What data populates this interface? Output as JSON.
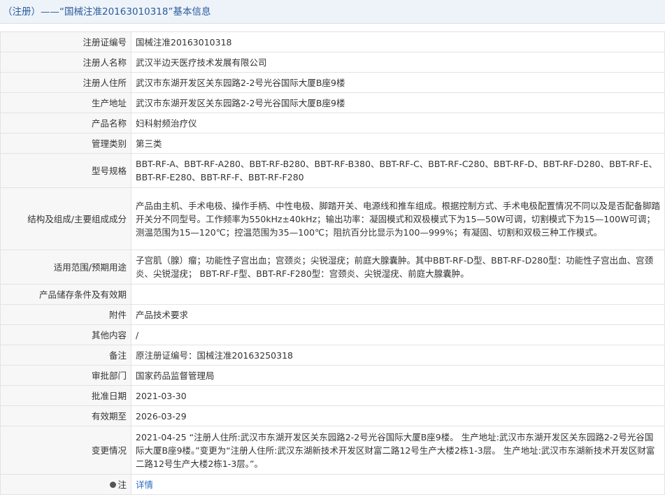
{
  "title": "（注册）——“国械注准20163010318”基本信息",
  "rows": [
    {
      "label": "注册证编号",
      "value": "国械注准20163010318"
    },
    {
      "label": "注册人名称",
      "value": "武汉半边天医疗技术发展有限公司"
    },
    {
      "label": "注册人住所",
      "value": "武汉市东湖开发区关东园路2-2号光谷国际大厦B座9楼"
    },
    {
      "label": "生产地址",
      "value": "武汉市东湖开发区关东园路2-2号光谷国际大厦B座9楼"
    },
    {
      "label": "产品名称",
      "value": "妇科射频治疗仪"
    },
    {
      "label": "管理类别",
      "value": "第三类"
    },
    {
      "label": "型号规格",
      "value": "BBT-RF-A、BBT-RF-A280、BBT-RF-B280、BBT-RF-B380、BBT-RF-C、BBT-RF-C280、BBT-RF-D、BBT-RF-D280、BBT-RF-E、BBT-RF-E280、BBT-RF-F、BBT-RF-F280"
    },
    {
      "label": "结构及组成/主要组成成分",
      "value": "产品由主机、手术电极、操作手柄、中性电极、脚踏开关、电源线和推车组成。根据控制方式、手术电极配置情况不同以及是否配备脚踏开关分不同型号。工作频率为550kHz±40kHz；输出功率：凝固模式和双极模式下为15—50W可调，切割模式下为15—100W可调；测温范围为15—120℃；控温范围为35—100℃；阻抗百分比显示为100—999%；有凝固、切割和双极三种工作模式。"
    },
    {
      "label": "适用范围/预期用途",
      "value": "子宫肌（腺）瘤；功能性子宫出血；宫颈炎；尖锐湿疣；前庭大腺囊肿。其中BBT-RF-D型、BBT-RF-D280型：功能性子宫出血、宫颈炎、尖锐湿疣； BBT-RF-F型、BBT-RF-F280型：宫颈炎、尖锐湿疣、前庭大腺囊肿。"
    },
    {
      "label": "产品储存条件及有效期",
      "value": ""
    },
    {
      "label": "附件",
      "value": "产品技术要求"
    },
    {
      "label": "其他内容",
      "value": "/"
    },
    {
      "label": "备注",
      "value": "原注册证编号：国械注准20163250318"
    },
    {
      "label": "审批部门",
      "value": "国家药品监督管理局"
    },
    {
      "label": "批准日期",
      "value": "2021-03-30"
    },
    {
      "label": "有效期至",
      "value": "2026-03-29"
    },
    {
      "label": "变更情况",
      "value": "2021-04-25 “注册人住所:武汉市东湖开发区关东园路2-2号光谷国际大厦B座9楼。 生产地址:武汉市东湖开发区关东园路2-2号光谷国际大厦B座9楼。”变更为“注册人住所:武汉东湖新技术开发区财富二路12号生产大楼2栋1-3层。 生产地址:武汉市东湖新技术开发区财富二路12号生产大楼2栋1-3层。”。"
    }
  ],
  "note": {
    "label": "注",
    "link_text": "详情",
    "icon": "lightbulb-icon"
  }
}
